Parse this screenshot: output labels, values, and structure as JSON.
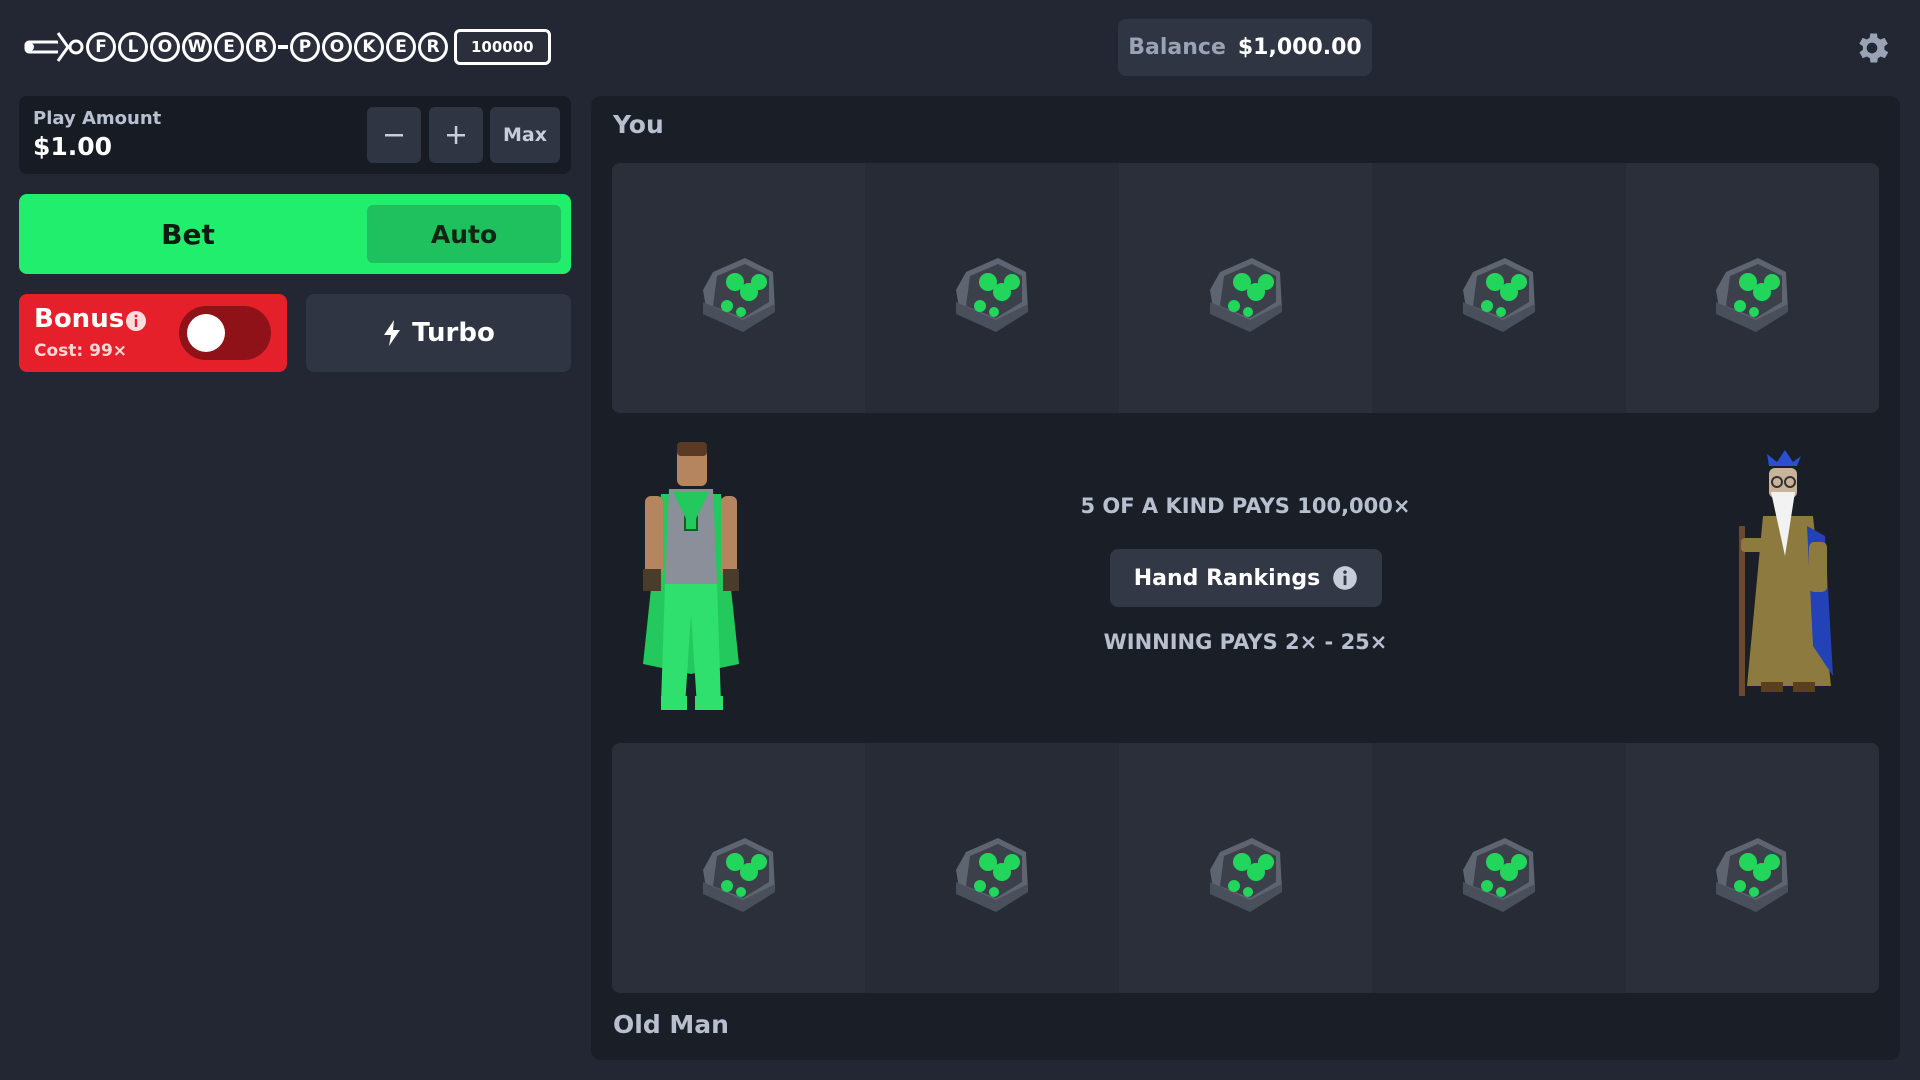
{
  "header": {
    "logo_letters": [
      "F",
      "L",
      "O",
      "W",
      "E",
      "R",
      "P",
      "O",
      "K",
      "E",
      "R"
    ],
    "logo_badge": "100000",
    "balance_label": "Balance",
    "balance_value": "$1,000.00",
    "settings_icon": "gear-icon"
  },
  "controls": {
    "play_amount_label": "Play Amount",
    "play_amount_value": "$1.00",
    "minus_icon": "minus-icon",
    "plus_icon": "plus-icon",
    "max_label": "Max",
    "bet_label": "Bet",
    "auto_label": "Auto",
    "bonus_label": "Bonus",
    "bonus_cost": "Cost: 99×",
    "bonus_enabled": false,
    "turbo_label": "Turbo",
    "turbo_icon": "lightning-icon"
  },
  "board": {
    "you_label": "You",
    "old_man_label": "Old Man",
    "five_kind_text": "5 OF A KIND PAYS 100,000×",
    "rankings_label": "Hand Rankings",
    "winning_text": "WINNING PAYS 2× - 25×",
    "you_slots": [
      "seed-pouch-icon",
      "seed-pouch-icon",
      "seed-pouch-icon",
      "seed-pouch-icon",
      "seed-pouch-icon"
    ],
    "old_man_slots": [
      "seed-pouch-icon",
      "seed-pouch-icon",
      "seed-pouch-icon",
      "seed-pouch-icon",
      "seed-pouch-icon"
    ]
  },
  "colors": {
    "background": "#222733",
    "bet_green": "#22ee6e",
    "auto_green": "#1ec15d",
    "bonus_red": "#e5202b",
    "flower_green": "#22d65c"
  }
}
